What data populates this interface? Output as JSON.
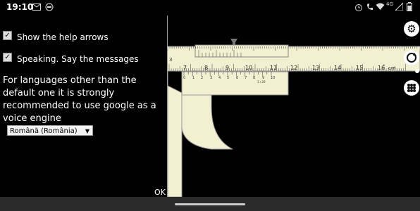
{
  "status": {
    "time": "19:10",
    "network": "4G"
  },
  "settings": {
    "show_help_arrows_label": "Show the help arrows",
    "show_help_arrows_checked": true,
    "speaking_label": "Speaking. Say the messages",
    "speaking_checked": true,
    "voice_note": "For languages other than the default one it is strongly recommended to use google as a voice engine",
    "language_selected": "Română (România)",
    "ok_label": "OK"
  },
  "caliper": {
    "main_scale_labels": [
      "3",
      "7",
      "8",
      "9",
      "10",
      "11",
      "12",
      "13",
      "14",
      "15",
      "16"
    ],
    "unit": "cm",
    "vernier_labels": [
      "0",
      "1",
      "2",
      "3",
      "4",
      "5",
      "6",
      "7",
      "8",
      "9",
      "10"
    ],
    "vernier_precision": "1 / 20"
  },
  "colors": {
    "scale_fill": "#f3f0d2",
    "panel_bg": "#000000",
    "navbar_bg": "#2b2b2b"
  },
  "icons": {
    "settings": "gear-icon",
    "rotate": "rotate-icon",
    "menu": "grid-menu-icon"
  }
}
